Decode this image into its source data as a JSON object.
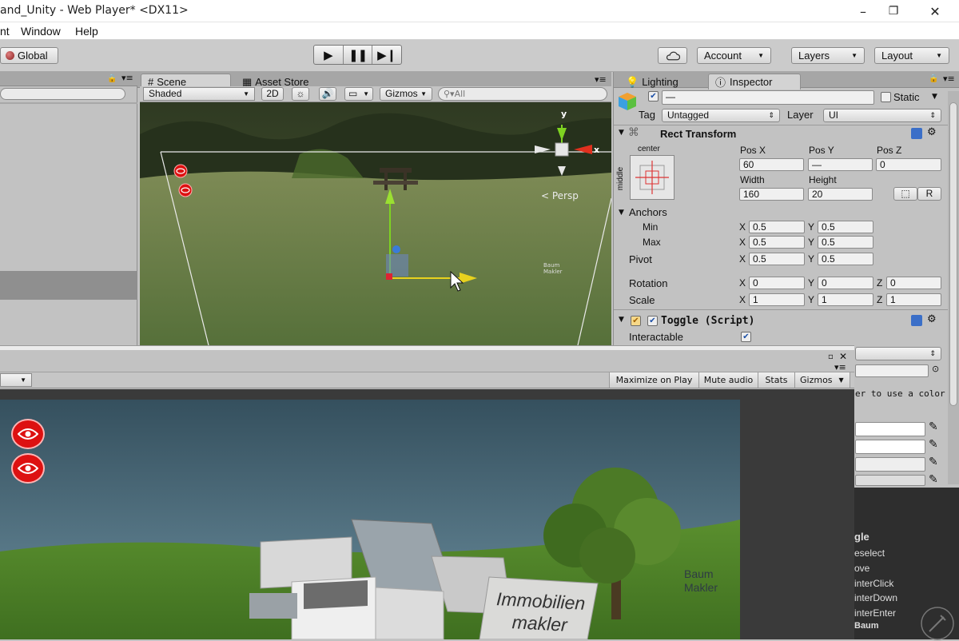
{
  "window": {
    "title": "and_Unity - Web Player* <DX11>",
    "controls": [
      "–",
      "❐",
      "✕"
    ]
  },
  "menubar": {
    "items": [
      "nt",
      "Window",
      "Help"
    ]
  },
  "toolbar": {
    "global_label": "Global",
    "account_label": "Account",
    "layers_label": "Layers",
    "layout_label": "Layout"
  },
  "scene": {
    "tabs": [
      "Scene",
      "Asset Store"
    ],
    "shading": "Shaded",
    "mode_2d": "2D",
    "gizmos": "Gizmos",
    "search_placeholder": "All",
    "persp_label": "< Persp",
    "gizmo_axes": [
      "y",
      "x"
    ],
    "faint_labels": [
      "Baum",
      "Makler"
    ]
  },
  "inspector": {
    "tabs": [
      "Lighting",
      "Inspector"
    ],
    "name_value": "—",
    "static_label": "Static",
    "tag_label": "Tag",
    "tag_value": "Untagged",
    "layer_label": "Layer",
    "layer_value": "UI",
    "rect_transform": {
      "title": "Rect Transform",
      "anchor_h": "center",
      "anchor_v": "middle",
      "pos_x_label": "Pos X",
      "pos_y_label": "Pos Y",
      "pos_z_label": "Pos Z",
      "pos_x": "60",
      "pos_y": "—",
      "pos_z": "0",
      "width_label": "Width",
      "height_label": "Height",
      "width": "160",
      "height": "20",
      "r_button": "R",
      "anchors_label": "Anchors",
      "min_label": "Min",
      "max_label": "Max",
      "pivot_label": "Pivot",
      "min_x": "0.5",
      "min_y": "0.5",
      "max_x": "0.5",
      "max_y": "0.5",
      "pivot_x": "0.5",
      "pivot_y": "0.5",
      "rotation_label": "Rotation",
      "rot_x": "0",
      "rot_y": "0",
      "rot_z": "0",
      "scale_label": "Scale",
      "scale_x": "1",
      "scale_y": "1",
      "scale_z": "1",
      "axis_x": "X",
      "axis_y": "Y",
      "axis_z": "Z"
    },
    "toggle": {
      "title": "Toggle (Script)",
      "interactable_label": "Interactable"
    },
    "partial_text": "er to use a color",
    "events": [
      "gle",
      "eselect",
      "ove",
      "interClick",
      "interDown",
      "interEnter",
      "Baum"
    ]
  },
  "game": {
    "maximize": "Maximize on Play",
    "mute": "Mute audio",
    "stats": "Stats",
    "gizmos": "Gizmos",
    "sign_line1": "Immobilien",
    "sign_line2": "makler",
    "tree_label1": "Baum",
    "tree_label2": "Makler"
  },
  "colors": {
    "toolbar_bg": "#cbcbcb",
    "panel_bg": "#c2c2c2",
    "eye_red": "#dd1111",
    "gizmo_y": "#7ed321",
    "gizmo_x": "#e0301e",
    "gizmo_z": "#3b7bd8"
  }
}
